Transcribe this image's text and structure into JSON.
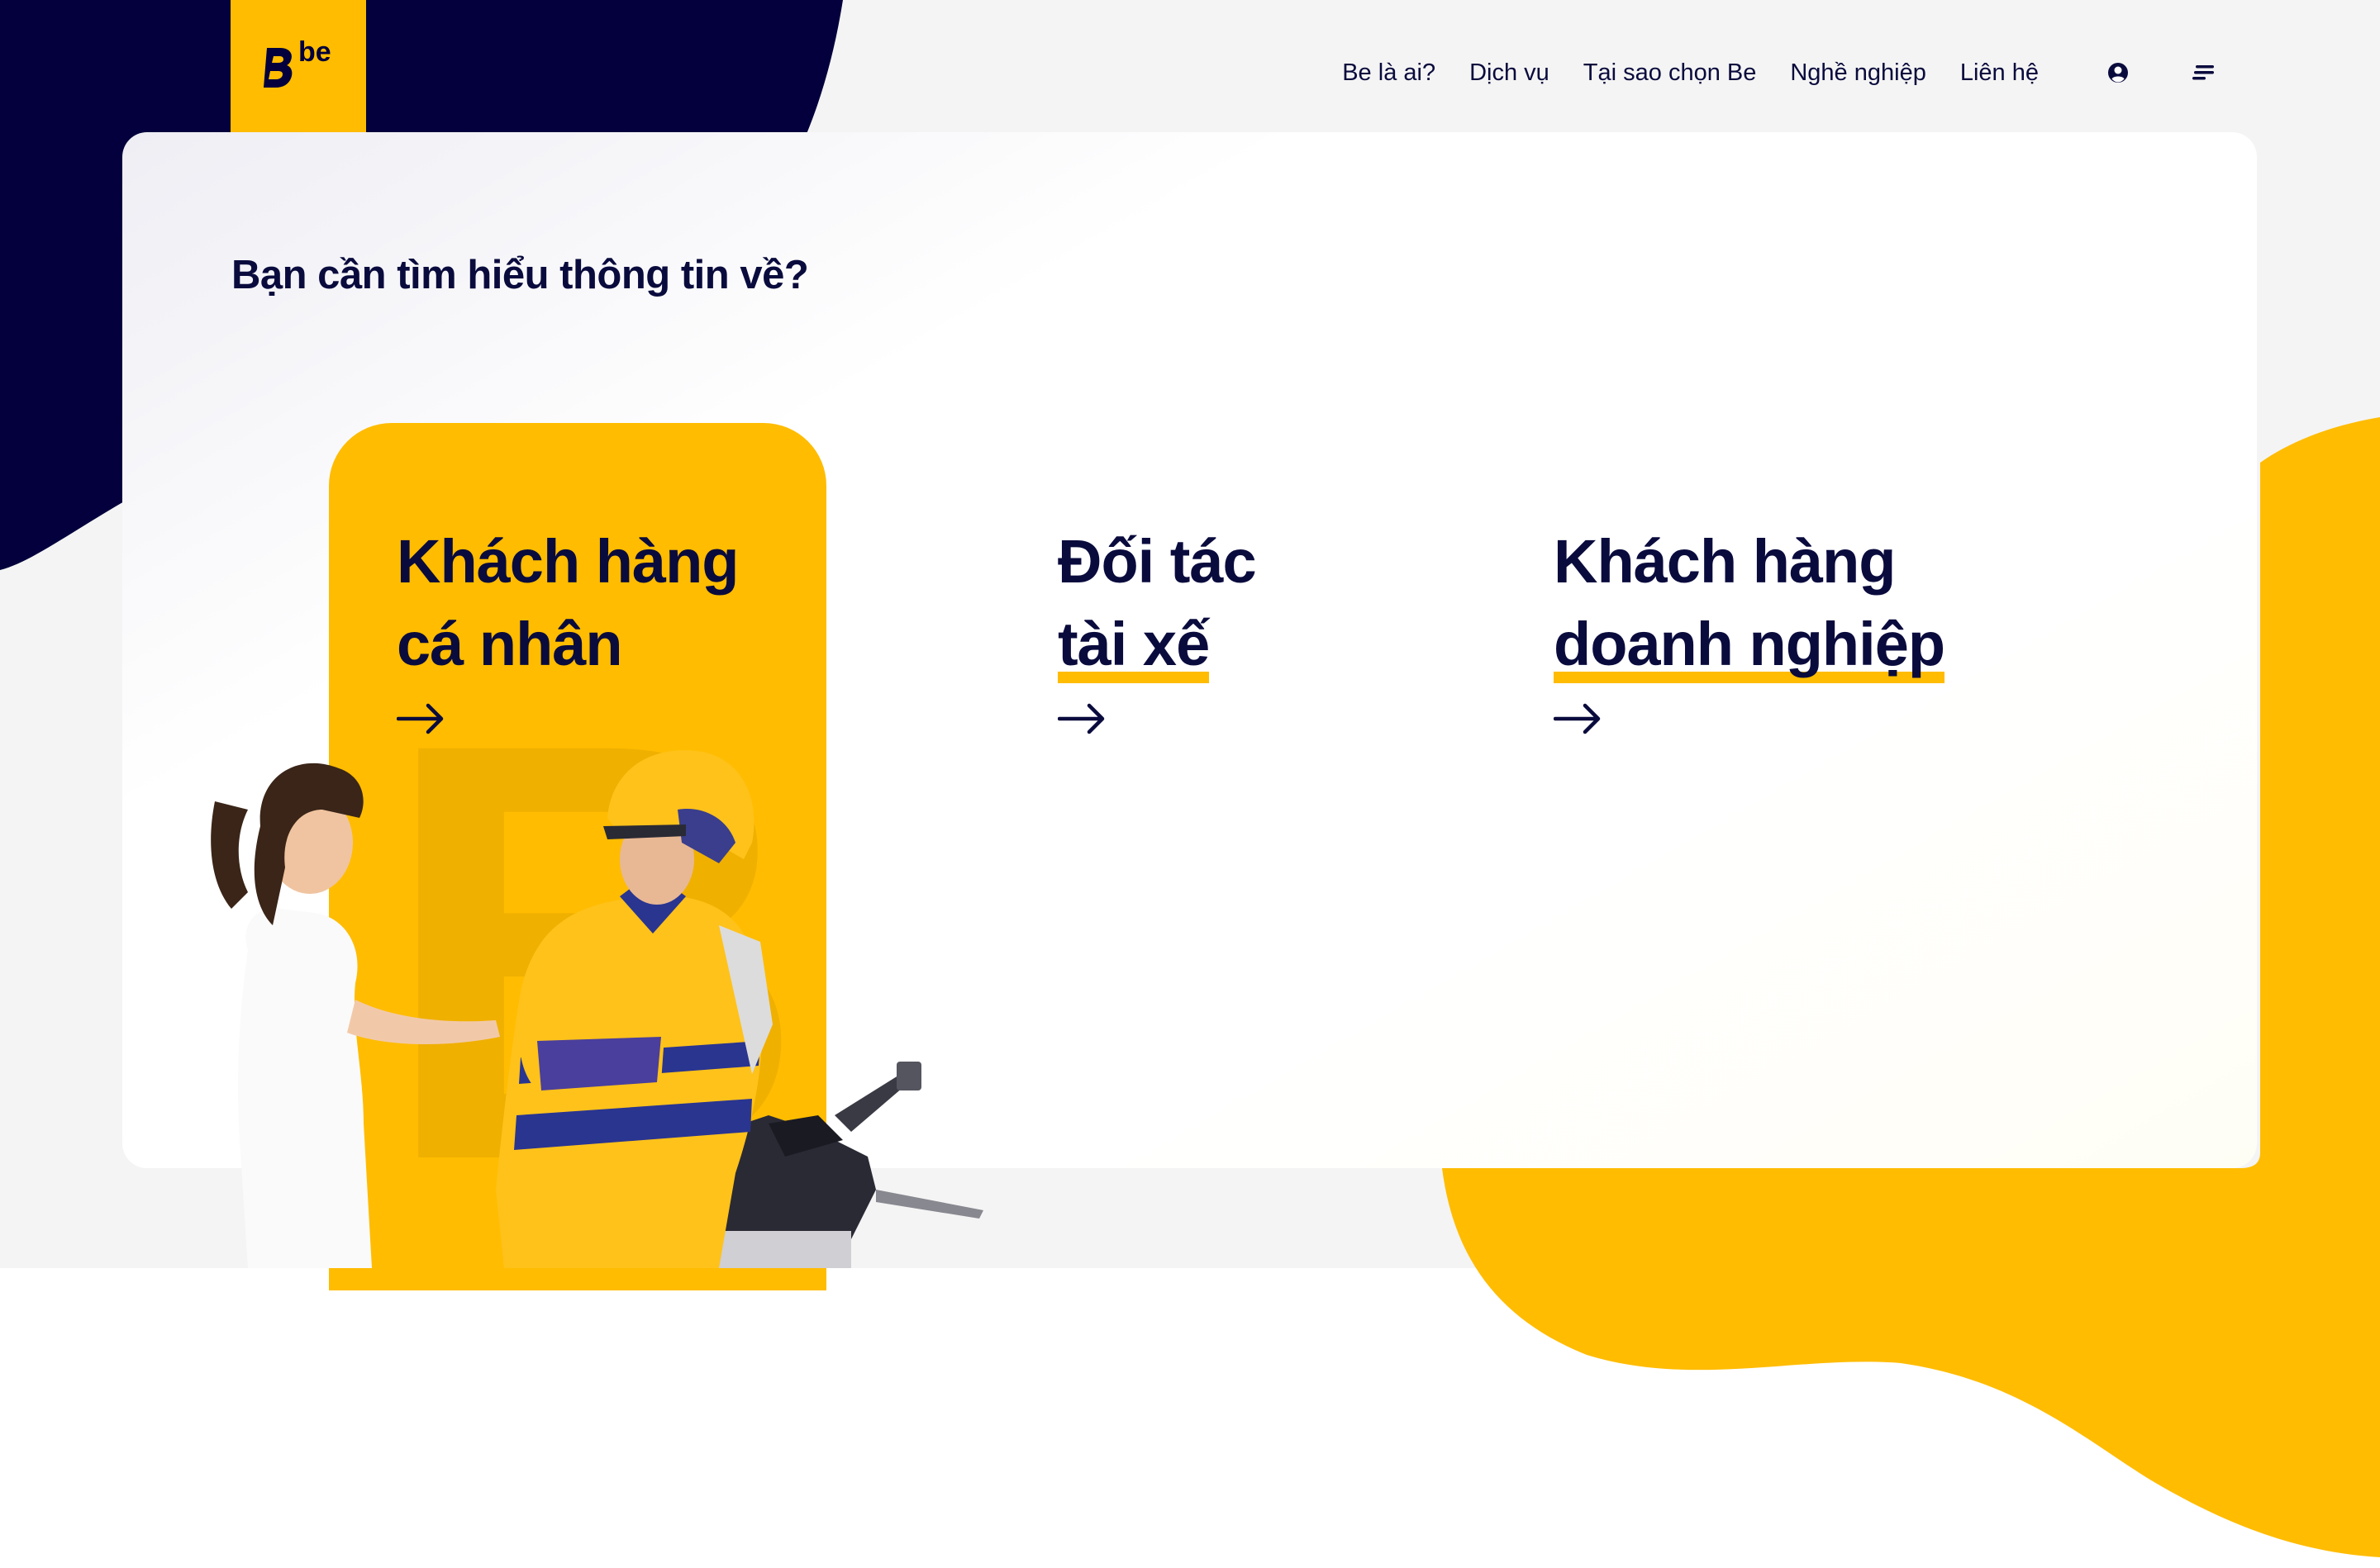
{
  "brand": {
    "logo_text": "be",
    "colors": {
      "navy": "#03003d",
      "yellow": "#ffbc00",
      "text": "#0a0b3d",
      "grey": "#f4f4f4"
    }
  },
  "nav": {
    "links": [
      {
        "label": "Be là ai?"
      },
      {
        "label": "Dịch vụ"
      },
      {
        "label": "Tại sao chọn Be"
      },
      {
        "label": "Nghề nghiệp"
      },
      {
        "label": "Liên hệ"
      }
    ],
    "icons": [
      "user-circle-icon",
      "menu-icon"
    ]
  },
  "main": {
    "heading": "Bạn cần tìm hiểu thông tin về?",
    "options": [
      {
        "line1": "Khách hàng",
        "line2": "cá nhân",
        "active": true
      },
      {
        "line1": "Đối tác",
        "line2": "tài xế",
        "active": false
      },
      {
        "line1": "Khách hàng",
        "line2": "doanh nghiệp",
        "active": false
      }
    ]
  }
}
